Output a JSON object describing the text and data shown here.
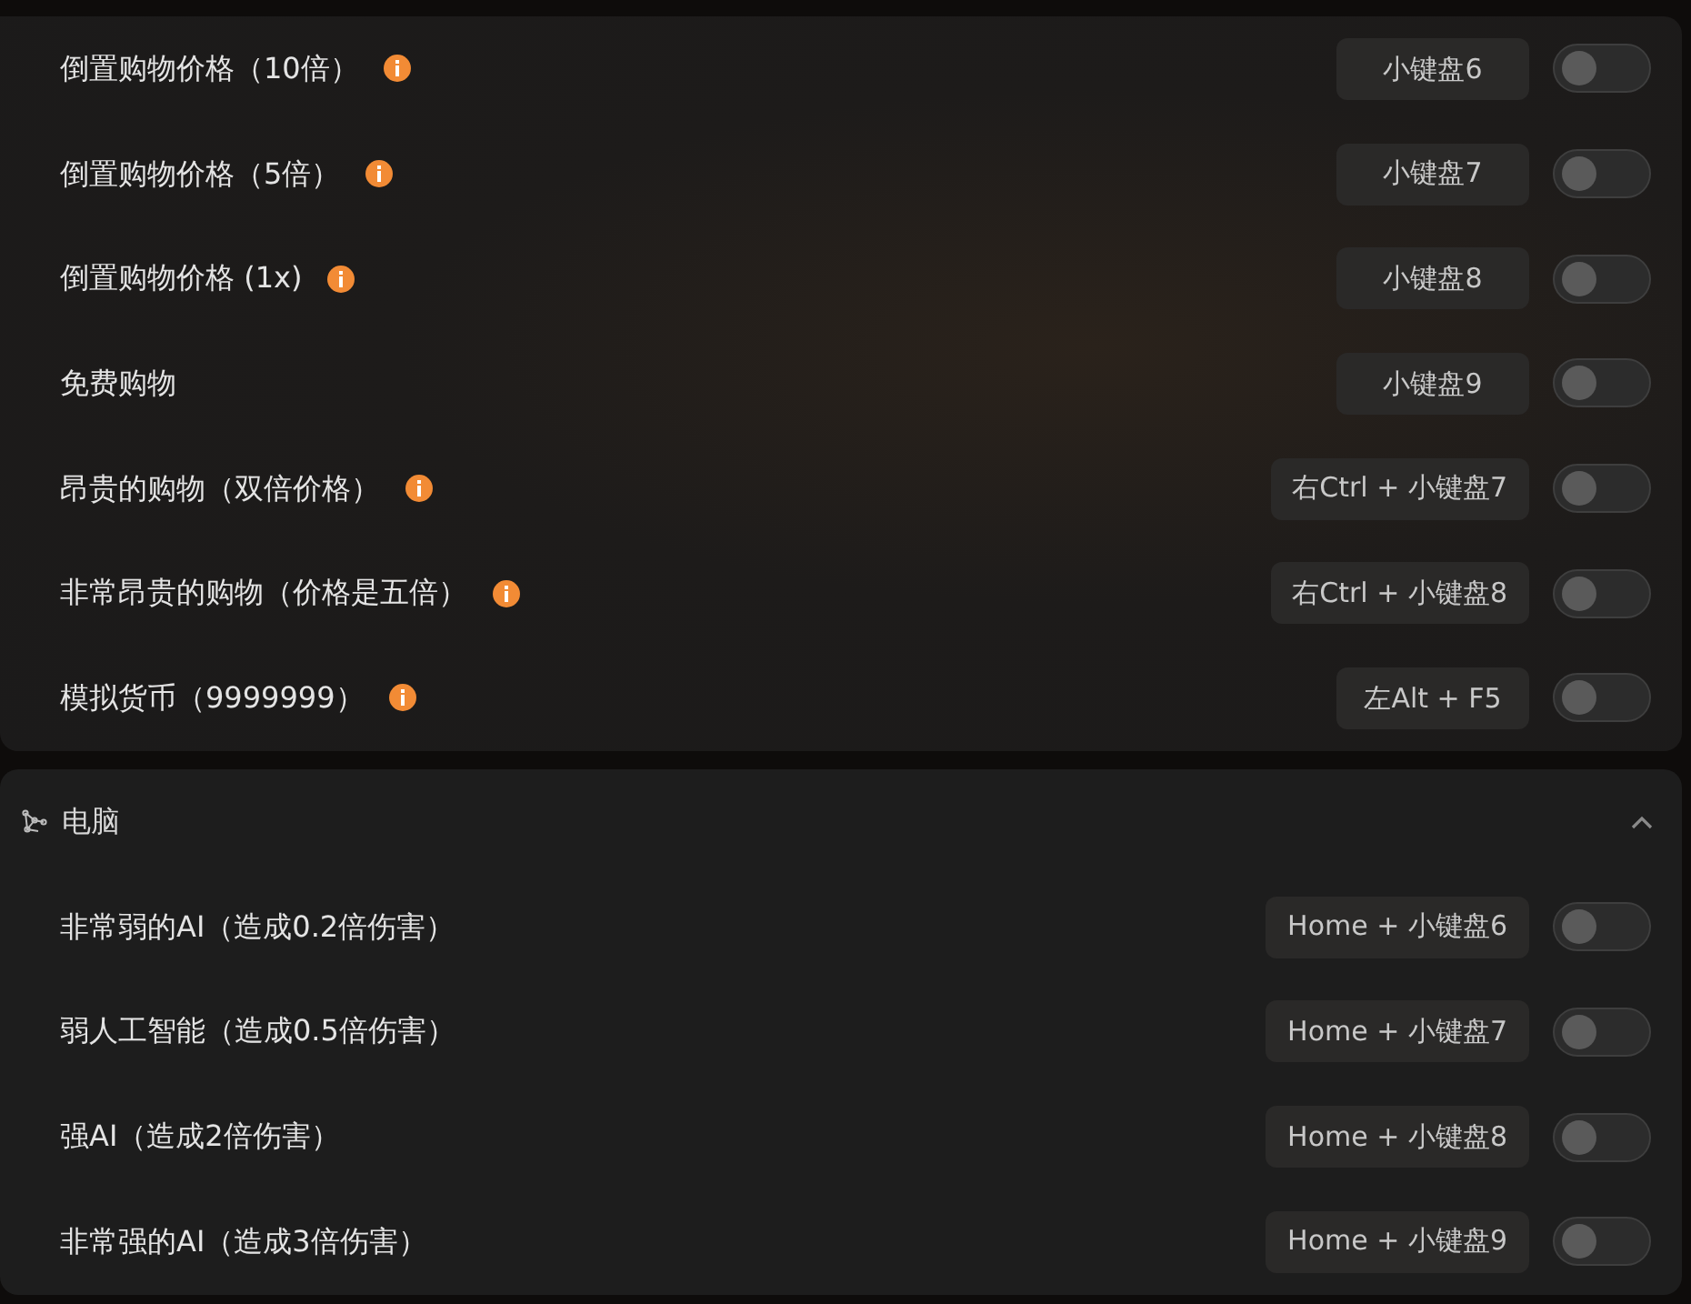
{
  "sections": [
    {
      "rows": [
        {
          "label": "倒置购物价格（10倍）",
          "info": true,
          "hotkey": "小键盘6",
          "on": false
        },
        {
          "label": "倒置购物价格（5倍）",
          "info": true,
          "hotkey": "小键盘7",
          "on": false
        },
        {
          "label": "倒置购物价格 (1x)",
          "info": true,
          "hotkey": "小键盘8",
          "on": false
        },
        {
          "label": "免费购物",
          "info": false,
          "hotkey": "小键盘9",
          "on": false
        },
        {
          "label": "昂贵的购物（双倍价格）",
          "info": true,
          "hotkey": "右Ctrl + 小键盘7",
          "on": false
        },
        {
          "label": "非常昂贵的购物（价格是五倍）",
          "info": true,
          "hotkey": "右Ctrl + 小键盘8",
          "on": false
        },
        {
          "label": "模拟货币（9999999）",
          "info": true,
          "hotkey": "左Alt + F5",
          "on": false
        }
      ]
    },
    {
      "title": "电脑",
      "expanded": true,
      "rows": [
        {
          "label": "非常弱的AI（造成0.2倍伤害）",
          "info": false,
          "hotkey": "Home + 小键盘6",
          "on": false
        },
        {
          "label": "弱人工智能（造成0.5倍伤害）",
          "info": false,
          "hotkey": "Home + 小键盘7",
          "on": false
        },
        {
          "label": "强AI（造成2倍伤害）",
          "info": false,
          "hotkey": "Home + 小键盘8",
          "on": false
        },
        {
          "label": "非常强的AI（造成3倍伤害）",
          "info": false,
          "hotkey": "Home + 小键盘9",
          "on": false
        }
      ]
    }
  ]
}
